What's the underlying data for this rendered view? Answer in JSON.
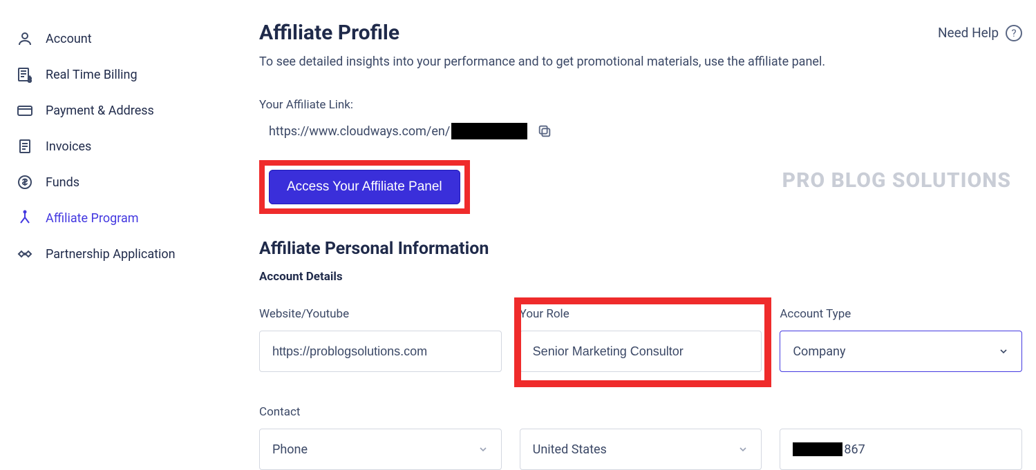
{
  "sidebar": {
    "items": [
      {
        "label": "Account",
        "icon": "person"
      },
      {
        "label": "Real Time Billing",
        "icon": "billing"
      },
      {
        "label": "Payment & Address",
        "icon": "card"
      },
      {
        "label": "Invoices",
        "icon": "invoice"
      },
      {
        "label": "Funds",
        "icon": "dollar"
      },
      {
        "label": "Affiliate Program",
        "icon": "merge",
        "active": true
      },
      {
        "label": "Partnership Application",
        "icon": "handshake"
      }
    ]
  },
  "header": {
    "title": "Affiliate Profile",
    "help_label": "Need Help",
    "subtitle": "To see detailed insights into your performance and to get promotional materials, use the affiliate panel."
  },
  "affiliate_link": {
    "label": "Your Affiliate Link:",
    "url_prefix": "https://www.cloudways.com/en/",
    "redacted": true
  },
  "cta": {
    "panel_button": "Access Your Affiliate Panel"
  },
  "watermark": "PRO BLOG SOLUTIONS",
  "section": {
    "title": "Affiliate Personal Information",
    "subtitle": "Account Details"
  },
  "form": {
    "website": {
      "label": "Website/Youtube",
      "value": "https://problogsolutions.com"
    },
    "role": {
      "label": "Your Role",
      "value": "Senior Marketing Consultor"
    },
    "account_type": {
      "label": "Account Type",
      "value": "Company"
    },
    "contact": {
      "label": "Contact",
      "value": "Phone"
    },
    "country": {
      "value": "United States"
    },
    "phone_suffix": "867"
  }
}
